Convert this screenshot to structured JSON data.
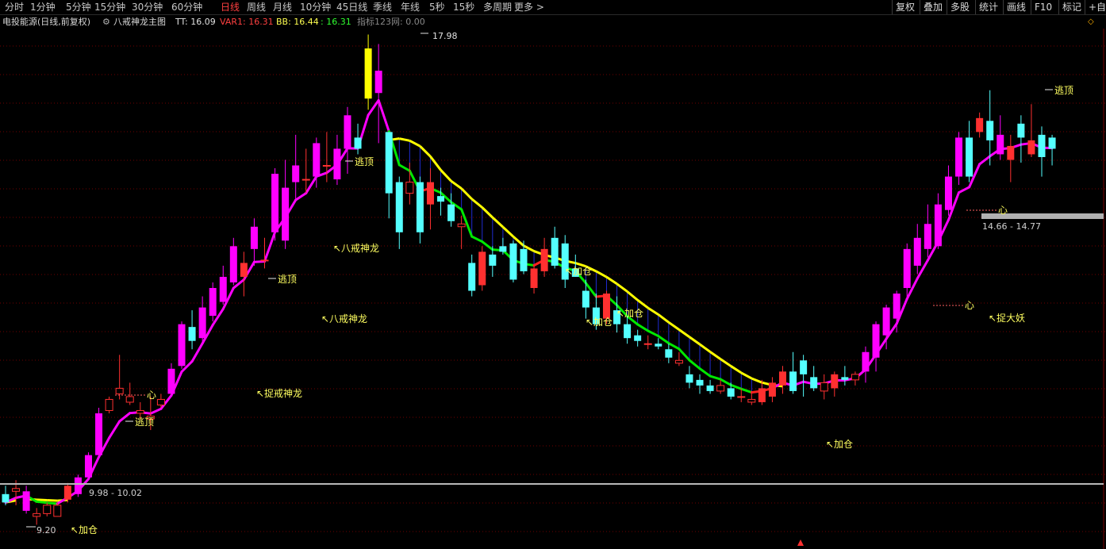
{
  "toolbar": {
    "periods": [
      "分时",
      "1分钟",
      "5分钟",
      "15分钟",
      "30分钟",
      "60分钟",
      "日线",
      "周线",
      "月线",
      "10分钟",
      "45日线",
      "季线",
      "年线",
      "5秒",
      "15秒",
      "多周期",
      "更多 >"
    ],
    "active_period": "日线",
    "right_buttons": [
      "复权",
      "叠加",
      "多股",
      "统计",
      "画线",
      "F10",
      "标记",
      "+自"
    ]
  },
  "infobar": {
    "stock_name": "电投能源(日线,前复权)",
    "formula_name": "八戒神龙主图",
    "tt_label": "TT: 16.09",
    "var1_label": "VAR1: 16.31",
    "bb_label": "BB: 16.44",
    "bb2_label": ": 16.31",
    "indicator_label": "指标123网: 0.00"
  },
  "colors": {
    "up": "#ff3030",
    "down": "#54ffff",
    "magenta": "#ff00ff",
    "yellow": "#ffff00",
    "green": "#00e800",
    "blue": "#1f2bd0",
    "annotation": "#ffff60",
    "grid": "#700000"
  },
  "annotations": [
    {
      "text": "17.98",
      "price": 17.98
    },
    {
      "text": "逃顶"
    },
    {
      "text": "逃顶"
    },
    {
      "text": "逃顶"
    },
    {
      "text": "逃顶"
    },
    {
      "text": "八戒神龙"
    },
    {
      "text": "八戒神龙"
    },
    {
      "text": "捉戒神龙"
    },
    {
      "text": "加仓"
    },
    {
      "text": "加仓"
    },
    {
      "text": "加仓"
    },
    {
      "text": "加仓"
    },
    {
      "text": "加仓"
    },
    {
      "text": "心"
    },
    {
      "text": "心"
    },
    {
      "text": "心"
    },
    {
      "text": "捉大妖"
    },
    {
      "text": "9.98 - 10.02",
      "low": 9.98,
      "high": 10.02
    },
    {
      "text": "14.66 - 14.77",
      "low": 14.66,
      "high": 14.77
    },
    {
      "text": "9.20",
      "price": 9.2
    }
  ],
  "chart_data": {
    "type": "candlestick",
    "price_range": [
      9.0,
      18.2
    ],
    "open": [
      9.9,
      9.95,
      9.6,
      9.5,
      9.55,
      9.5,
      9.8,
      9.9,
      10.2,
      10.6,
      11.4,
      11.7,
      11.55,
      11.35,
      11.25,
      11.5,
      11.7,
      12.2,
      12.9,
      12.7,
      13.1,
      13.35,
      13.7,
      13.8,
      14.3,
      14.1,
      14.6,
      14.45,
      15.5,
      15.55,
      15.6,
      15.8,
      15.55,
      16.1,
      16.3,
      17.0,
      17.1,
      16.4,
      15.5,
      15.3,
      15.5,
      15.1,
      15.25,
      15.1,
      14.7,
      14.05,
      13.65,
      14.2,
      14.35,
      14.4,
      14.3,
      13.6,
      13.9,
      14.5,
      14.4,
      13.95,
      13.55,
      13.25,
      13.05,
      13.2,
      12.95,
      12.75,
      12.6,
      12.6,
      12.5,
      12.25,
      12.05,
      11.95,
      11.85,
      11.75,
      11.8,
      11.65,
      11.55,
      11.55,
      11.65,
      11.85,
      12.1,
      12.3,
      12.0,
      11.75,
      11.8,
      12.0,
      11.95,
      12.1,
      12.35,
      12.75,
      13.05,
      13.6,
      14.0,
      14.3,
      14.35,
      15.0,
      15.6,
      16.3,
      16.4,
      16.6,
      16.0,
      15.9,
      16.55,
      16.0,
      16.35,
      16.3
    ],
    "close": [
      9.75,
      10.0,
      9.95,
      9.55,
      9.7,
      9.7,
      10.05,
      10.2,
      10.6,
      11.35,
      11.6,
      11.8,
      11.65,
      11.4,
      11.3,
      11.6,
      12.15,
      12.95,
      12.65,
      13.25,
      13.6,
      13.8,
      14.35,
      14.05,
      14.7,
      14.1,
      15.65,
      15.4,
      15.8,
      15.55,
      16.2,
      15.8,
      16.1,
      16.7,
      16.1,
      17.9,
      17.5,
      15.3,
      14.6,
      15.5,
      14.6,
      15.5,
      15.15,
      14.8,
      14.75,
      13.55,
      14.25,
      14.0,
      14.25,
      13.75,
      13.9,
      13.95,
      14.3,
      14.0,
      13.75,
      13.8,
      13.25,
      12.95,
      13.5,
      12.95,
      12.7,
      12.65,
      12.6,
      12.55,
      12.35,
      12.3,
      11.9,
      11.85,
      11.75,
      11.85,
      11.65,
      11.65,
      11.6,
      11.8,
      11.9,
      12.1,
      11.75,
      12.05,
      11.8,
      11.9,
      12.05,
      11.95,
      12.05,
      12.45,
      12.95,
      13.25,
      13.5,
      14.3,
      14.5,
      14.75,
      15.1,
      15.6,
      16.3,
      15.6,
      16.65,
      16.25,
      16.35,
      16.15,
      16.3,
      16.25,
      15.95,
      16.1
    ],
    "high": [
      10.05,
      10.15,
      10.05,
      9.65,
      9.75,
      9.75,
      10.1,
      10.25,
      10.65,
      11.45,
      11.65,
      12.4,
      11.9,
      11.55,
      11.65,
      11.7,
      12.25,
      13.0,
      13.2,
      13.45,
      13.7,
      14.0,
      14.5,
      14.25,
      14.85,
      14.5,
      15.75,
      15.9,
      16.35,
      16.1,
      16.3,
      16.4,
      16.35,
      16.85,
      16.55,
      18.15,
      17.98,
      16.05,
      15.6,
      15.85,
      15.6,
      15.75,
      15.4,
      15.3,
      14.9,
      14.2,
      14.35,
      14.35,
      14.5,
      14.45,
      14.45,
      14.0,
      14.5,
      14.7,
      14.55,
      14.2,
      13.75,
      13.5,
      13.55,
      13.45,
      13.1,
      12.85,
      12.75,
      12.7,
      12.6,
      12.45,
      12.2,
      12.05,
      11.95,
      11.95,
      11.9,
      11.8,
      11.75,
      11.95,
      12.0,
      12.2,
      12.45,
      12.4,
      12.2,
      12.05,
      12.1,
      12.2,
      12.1,
      12.55,
      13.0,
      13.3,
      13.55,
      14.4,
      14.75,
      15.1,
      15.3,
      15.8,
      16.4,
      16.6,
      16.75,
      17.15,
      16.7,
      16.35,
      16.7,
      16.9,
      16.5,
      16.35
    ],
    "low": [
      9.7,
      9.7,
      9.55,
      9.35,
      9.5,
      9.5,
      9.75,
      9.85,
      10.15,
      10.55,
      11.35,
      11.6,
      11.5,
      11.25,
      11.05,
      11.45,
      11.65,
      12.15,
      12.5,
      12.6,
      13.0,
      13.3,
      13.65,
      13.45,
      14.0,
      13.95,
      14.45,
      14.3,
      15.2,
      15.3,
      15.4,
      15.5,
      15.45,
      15.65,
      16.0,
      16.8,
      16.2,
      14.85,
      14.3,
      15.1,
      14.4,
      14.65,
      14.9,
      14.7,
      14.3,
      13.45,
      13.55,
      13.8,
      14.2,
      13.7,
      13.85,
      13.5,
      13.8,
      13.95,
      13.6,
      13.8,
      13.05,
      12.85,
      12.95,
      12.8,
      12.6,
      12.55,
      12.5,
      12.5,
      12.25,
      12.2,
      11.8,
      11.7,
      11.7,
      11.7,
      11.6,
      11.55,
      11.5,
      11.5,
      11.55,
      11.7,
      11.7,
      11.65,
      11.75,
      11.6,
      11.65,
      11.85,
      11.85,
      11.9,
      12.1,
      12.5,
      12.8,
      13.4,
      13.85,
      14.15,
      14.3,
      14.9,
      15.45,
      15.5,
      16.3,
      15.8,
      15.9,
      15.5,
      15.85,
      15.95,
      15.6,
      15.8
    ]
  }
}
